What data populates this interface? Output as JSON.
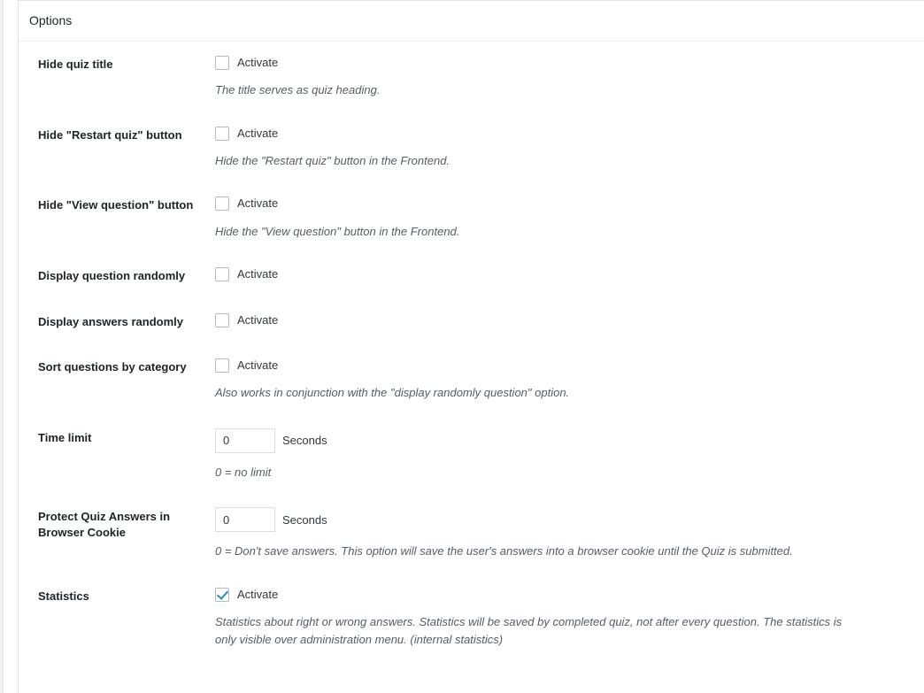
{
  "panel": {
    "title": "Options"
  },
  "rows": [
    {
      "label": "Hide quiz title",
      "control": "checkbox",
      "checked": false,
      "activate_label": "Activate",
      "description": "The title serves as quiz heading."
    },
    {
      "label": "Hide \"Restart quiz\" button",
      "control": "checkbox",
      "checked": false,
      "activate_label": "Activate",
      "description": "Hide the \"Restart quiz\" button in the Frontend."
    },
    {
      "label": "Hide \"View question\" button",
      "control": "checkbox",
      "checked": false,
      "activate_label": "Activate",
      "description": "Hide the \"View question\" button in the Frontend."
    },
    {
      "label": "Display question randomly",
      "control": "checkbox",
      "checked": false,
      "activate_label": "Activate",
      "description": ""
    },
    {
      "label": "Display answers randomly",
      "control": "checkbox",
      "checked": false,
      "activate_label": "Activate",
      "description": ""
    },
    {
      "label": "Sort questions by category",
      "control": "checkbox",
      "checked": false,
      "activate_label": "Activate",
      "description": "Also works in conjunction with the \"display randomly question\" option."
    },
    {
      "label": "Time limit",
      "control": "number",
      "value": "0",
      "unit": "Seconds",
      "description": "0 = no limit"
    },
    {
      "label": "Protect Quiz Answers in Browser Cookie",
      "control": "number",
      "value": "0",
      "unit": "Seconds",
      "description": "0 = Don't save answers. This option will save the user's answers into a browser cookie until the Quiz is submitted."
    },
    {
      "label": "Statistics",
      "control": "checkbox",
      "checked": true,
      "activate_label": "Activate",
      "description": "Statistics about right or wrong answers. Statistics will be saved by completed quiz, not after every question. The statistics is only visible over administration menu. (internal statistics)"
    }
  ],
  "colors": {
    "accent": "#1e8cbe",
    "panel_border": "#e2e4e7",
    "label_text": "#1d2327",
    "desc_text": "#555d66",
    "page_bg": "#f1f1f1"
  }
}
